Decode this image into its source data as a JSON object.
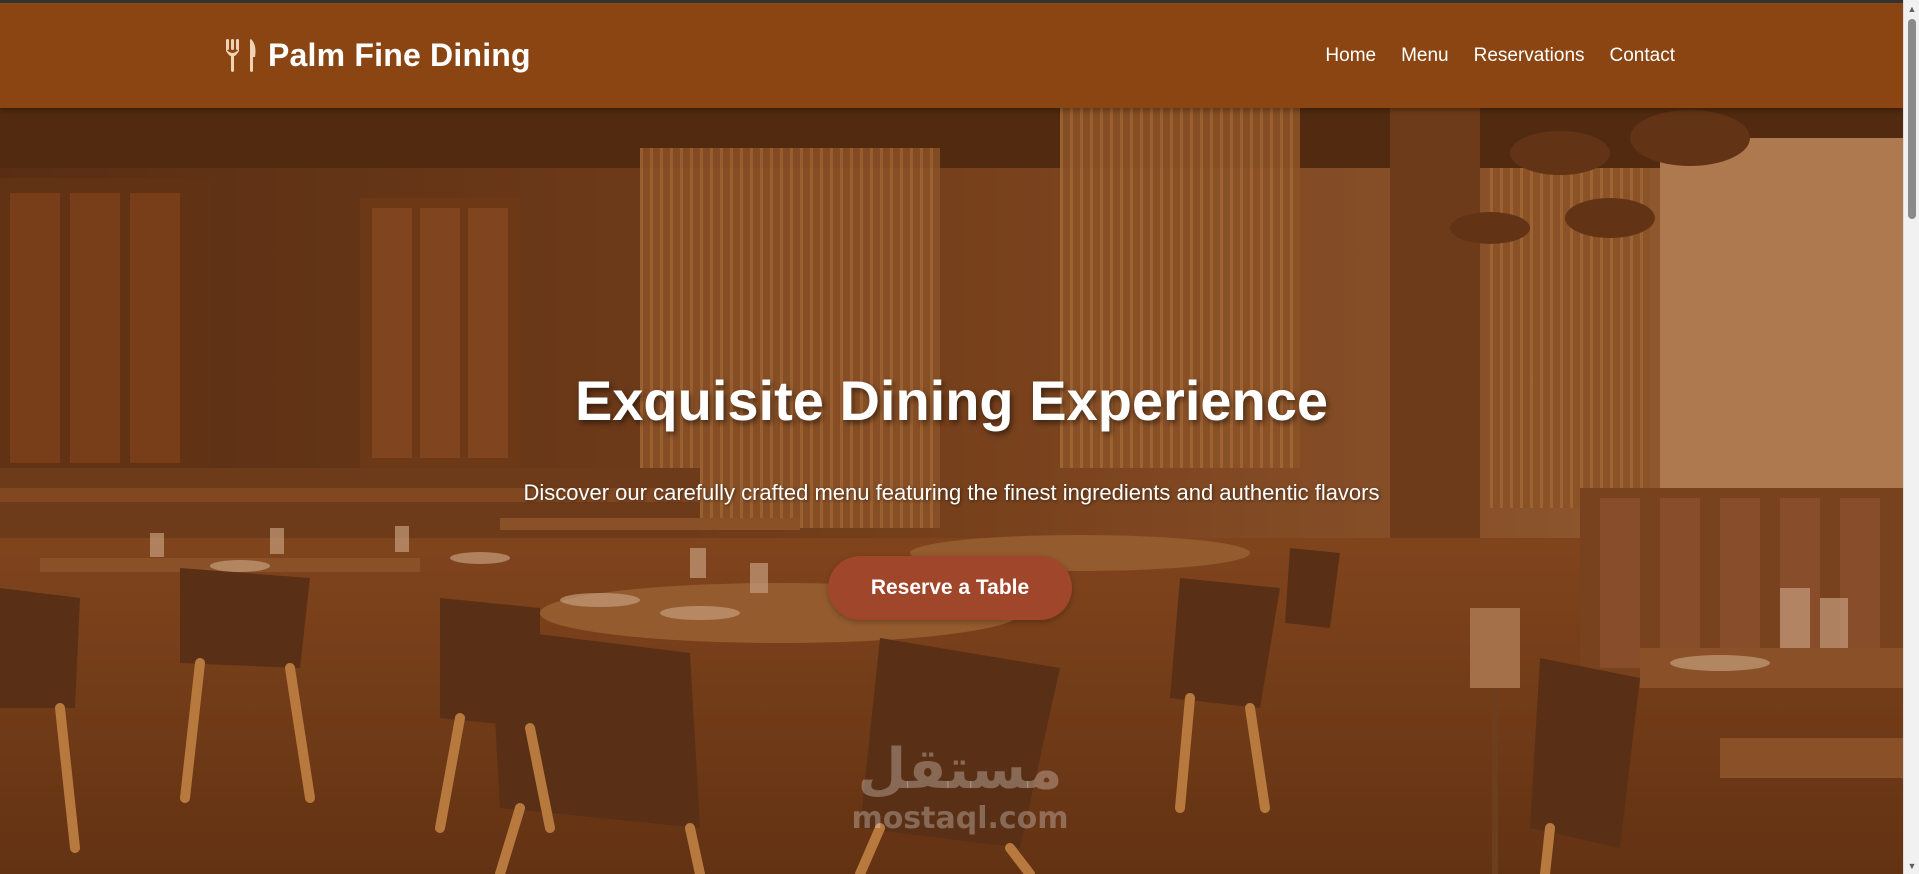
{
  "brand": {
    "name": "Palm Fine Dining",
    "icon": "utensils-icon"
  },
  "nav": {
    "items": [
      {
        "label": "Home"
      },
      {
        "label": "Menu"
      },
      {
        "label": "Reservations"
      },
      {
        "label": "Contact"
      }
    ]
  },
  "hero": {
    "title": "Exquisite Dining Experience",
    "subtitle": "Discover our carefully crafted menu featuring the finest ingredients and authentic flavors",
    "cta_label": "Reserve a Table",
    "background": "restaurant-interior-photo"
  },
  "watermark": {
    "arabic": "مستقل",
    "latin": "mostaql.com"
  },
  "colors": {
    "navbar": "#8b4513",
    "cta": "#a0462b",
    "text": "#ffffff"
  }
}
